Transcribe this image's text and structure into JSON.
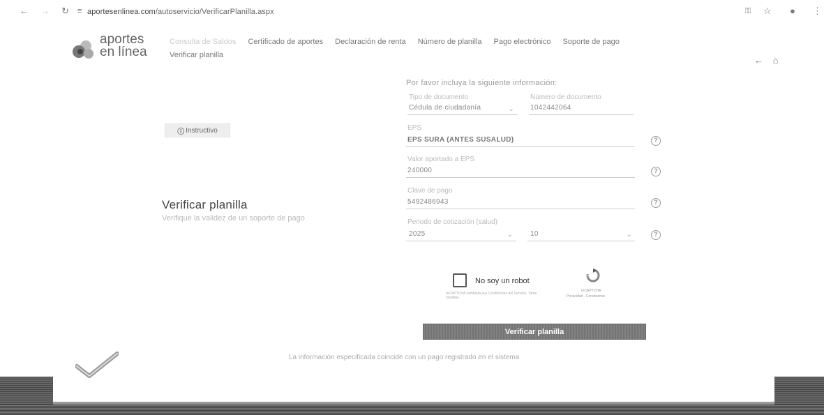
{
  "browser": {
    "back_icon": "arrow-left-icon",
    "forward_icon": "arrow-right-icon",
    "reload_icon": "reload-icon",
    "site_info_icon": "site-settings-icon",
    "url_host": "aportesenlinea.com",
    "url_path": "/autoservicio/VerificarPlanilla.aspx",
    "key_icon": "key-icon",
    "star_icon": "star-icon",
    "profile_icon": "profile-icon",
    "menu_icon": "kebab-menu-icon"
  },
  "logo": {
    "line1": "aportes",
    "line2": "en línea"
  },
  "nav": {
    "items": [
      {
        "label": "Consulta de Saldos"
      },
      {
        "label": "Certificado de aportes"
      },
      {
        "label": "Declaración de renta"
      },
      {
        "label": "Número de planilla"
      },
      {
        "label": "Pago electrónico"
      },
      {
        "label": "Soporte de pago"
      },
      {
        "label": "Verificar planilla"
      }
    ]
  },
  "top_actions": {
    "back_icon": "arrow-left-icon",
    "home_icon": "home-icon"
  },
  "instructivo": {
    "label": "Instructivo",
    "icon": "info-icon"
  },
  "page": {
    "title": "Verificar planilla",
    "subtitle": "Verifique la validez de un soporte de pago"
  },
  "form": {
    "intro": "Por favor incluya la siguiente información:",
    "doc_type_label": "Tipo de documento",
    "doc_type_value": "Cédula de ciudadanía",
    "doc_number_label": "Número de documento",
    "doc_number_value": "1042442064",
    "eps_label": "EPS",
    "eps_value": "EPS SURA (ANTES SUSALUD)",
    "valor_label": "Valor aportado a EPS",
    "valor_value": "240000",
    "clave_label": "Clave de pago",
    "clave_value": "5492486943",
    "periodo_label": "Periodo de cotización (salud)",
    "periodo_year": "2025",
    "periodo_month": "10",
    "help_icon": "help-icon"
  },
  "captcha": {
    "label": "No soy un robot",
    "small_text": "reCAPTCHA cambiará sus Condiciones del Servicio. Tome medidas",
    "brand": "reCAPTCHA",
    "links": "Privacidad - Condiciones"
  },
  "verify_button": "Verificar planilla",
  "result_text": "La información especificada coincide con un pago registrado en el sistema",
  "result_icon": "checkmark-icon"
}
